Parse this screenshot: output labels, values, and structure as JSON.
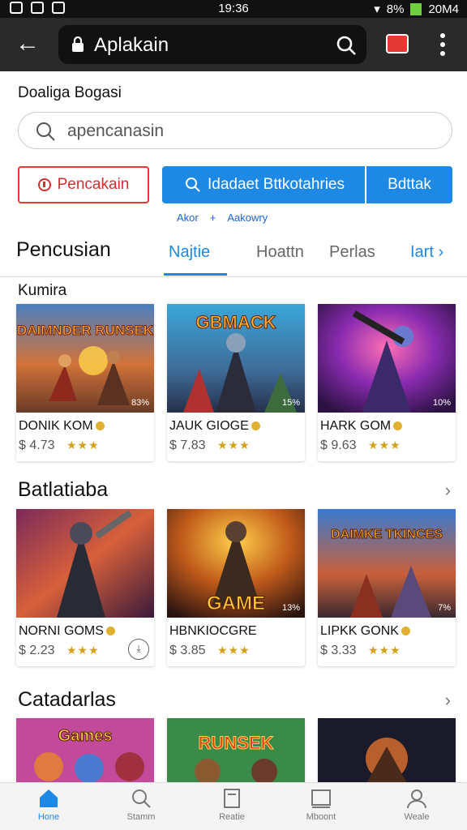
{
  "status": {
    "time": "19:36",
    "battery": "8%",
    "signal": "20M4"
  },
  "browser": {
    "url": "Aplakain"
  },
  "header_label": "Doaliga Bogasi",
  "search": {
    "value": "apencanasin"
  },
  "buttons": {
    "red": "Pencakain",
    "blue": "Idadaet Bttkotahries",
    "blue2": "Bdttak"
  },
  "sub_links": [
    "Akor",
    "+",
    "Aakowry"
  ],
  "tabs": {
    "title": "Pencusian",
    "items": [
      "Najtie",
      "Hoattn",
      "Perlas",
      "Iart"
    ]
  },
  "tiny_label": "Kumira",
  "sections": [
    {
      "title": "",
      "cards": [
        {
          "title": "DONIK KOM",
          "price": "$ 4.73",
          "stars": "★★★",
          "badge": "83%",
          "art": "DAIMNDER RUNSEK"
        },
        {
          "title": "JAUK GIOGE",
          "price": "$ 7.83",
          "stars": "★★★",
          "badge": "15%",
          "art": "GBMACK"
        },
        {
          "title": "HARK GOM",
          "price": "$ 9.63",
          "stars": "★★★",
          "badge": "10%",
          "art": ""
        }
      ]
    },
    {
      "title": "Batlatiaba",
      "cards": [
        {
          "title": "NORNI GOMS",
          "price": "$ 2.23",
          "stars": "★★★",
          "badge": "",
          "art": ""
        },
        {
          "title": "HBNKIOCGRE",
          "price": "$ 3.85",
          "stars": "★★★",
          "badge": "13%",
          "art": "GAME"
        },
        {
          "title": "LIPKK GONK",
          "price": "$ 3.33",
          "stars": "★★★",
          "badge": "7%",
          "art": "DAIMKE TKINCES"
        }
      ]
    },
    {
      "title": "Catadarlas",
      "cards": [
        {
          "title": "",
          "price": "",
          "stars": "",
          "badge": "",
          "art": "Games"
        },
        {
          "title": "",
          "price": "",
          "stars": "",
          "badge": "",
          "art": "RUNSEK"
        },
        {
          "title": "",
          "price": "",
          "stars": "",
          "badge": "",
          "art": ""
        }
      ]
    }
  ],
  "bottom_nav": [
    "Hone",
    "Stamm",
    "Reatie",
    "Mboont",
    "Weale"
  ],
  "colors": {
    "accent": "#1e88e5",
    "red": "#e53935",
    "star": "#d4a017"
  }
}
